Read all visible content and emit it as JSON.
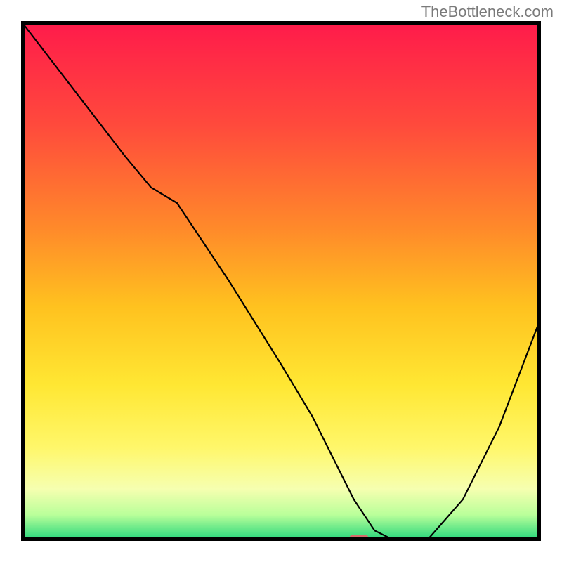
{
  "watermark": "TheBottleneck.com",
  "chart_data": {
    "type": "line",
    "title": "",
    "xlabel": "",
    "ylabel": "",
    "xlim": [
      0,
      100
    ],
    "ylim": [
      0,
      100
    ],
    "grid": false,
    "background": "red-yellow-green vertical gradient",
    "series": [
      {
        "name": "bottleneck-curve",
        "x": [
          0,
          10,
          20,
          25,
          30,
          40,
          50,
          56,
          60,
          64,
          68,
          72,
          78,
          85,
          92,
          100
        ],
        "y": [
          100,
          87,
          74,
          68,
          65,
          50,
          34,
          24,
          16,
          8,
          2,
          0,
          0,
          8,
          22,
          43
        ]
      }
    ],
    "marker": {
      "x": 65,
      "y": 0,
      "shape": "rounded-rect",
      "color": "#d66b6b"
    },
    "gradient_stops": [
      {
        "offset": 0.0,
        "color": "#ff1a4b"
      },
      {
        "offset": 0.2,
        "color": "#ff4a3c"
      },
      {
        "offset": 0.4,
        "color": "#ff8a2a"
      },
      {
        "offset": 0.55,
        "color": "#ffc21f"
      },
      {
        "offset": 0.7,
        "color": "#ffe733"
      },
      {
        "offset": 0.82,
        "color": "#fff76a"
      },
      {
        "offset": 0.9,
        "color": "#f6ffb0"
      },
      {
        "offset": 0.95,
        "color": "#b9ff9a"
      },
      {
        "offset": 1.0,
        "color": "#1fd47a"
      }
    ]
  }
}
